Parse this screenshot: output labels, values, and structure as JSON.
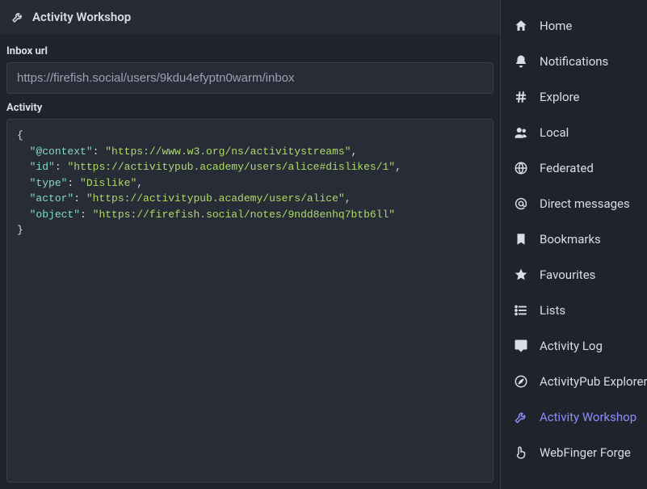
{
  "header": {
    "title": "Activity Workshop"
  },
  "form": {
    "inbox_label": "Inbox url",
    "inbox_value": "https://firefish.social/users/9kdu4efyptn0warm/inbox",
    "activity_label": "Activity",
    "activity_json": {
      "@context": "https://www.w3.org/ns/activitystreams",
      "id": "https://activitypub.academy/users/alice#dislikes/1",
      "type": "Dislike",
      "actor": "https://activitypub.academy/users/alice",
      "object": "https://firefish.social/notes/9ndd8enhq7btb6ll"
    }
  },
  "nav": {
    "items": [
      {
        "label": "Home",
        "icon": "home-icon",
        "active": false
      },
      {
        "label": "Notifications",
        "icon": "bell-icon",
        "active": false
      },
      {
        "label": "Explore",
        "icon": "hashtag-icon",
        "active": false
      },
      {
        "label": "Local",
        "icon": "users-icon",
        "active": false
      },
      {
        "label": "Federated",
        "icon": "globe-icon",
        "active": false
      },
      {
        "label": "Direct messages",
        "icon": "at-icon",
        "active": false
      },
      {
        "label": "Bookmarks",
        "icon": "bookmark-icon",
        "active": false
      },
      {
        "label": "Favourites",
        "icon": "star-icon",
        "active": false
      },
      {
        "label": "Lists",
        "icon": "list-icon",
        "active": false
      },
      {
        "label": "Activity Log",
        "icon": "chat-icon",
        "active": false
      },
      {
        "label": "ActivityPub Explorer",
        "icon": "compass-icon",
        "active": false
      },
      {
        "label": "Activity Workshop",
        "icon": "wrench-icon",
        "active": true
      },
      {
        "label": "WebFinger Forge",
        "icon": "point-icon",
        "active": false
      }
    ]
  }
}
